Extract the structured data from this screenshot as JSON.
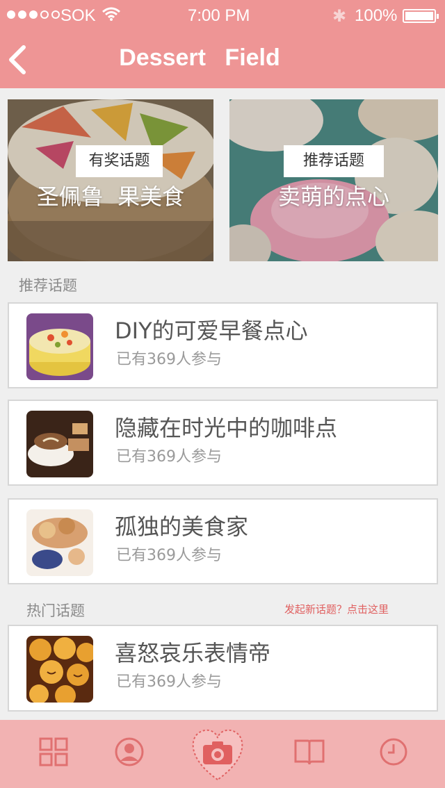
{
  "status_bar": {
    "carrier": "SOK",
    "time": "7:00 PM",
    "battery": "100%"
  },
  "nav": {
    "title": "Dessert Field"
  },
  "banners": [
    {
      "tag": "有奖话题",
      "title": "圣佩鲁 果美食"
    },
    {
      "tag": "推荐话题",
      "title": "卖萌的点心"
    }
  ],
  "sections": {
    "recommended": "推荐话题",
    "hot": "热门话题",
    "new_topic_link": "发起新话题？点击这里"
  },
  "topics": [
    {
      "title": "DIY的可爱早餐点心",
      "participants": "已有369人参与"
    },
    {
      "title": "隐藏在时光中的咖啡点",
      "participants": "已有369人参与"
    },
    {
      "title": "孤独的美食家",
      "participants": "已有369人参与"
    },
    {
      "title": "喜怒哀乐表情帝",
      "participants": "已有369人参与"
    }
  ],
  "tabbar": {
    "items": [
      "grid-icon",
      "profile-icon",
      "camera-icon",
      "book-icon",
      "clock-icon"
    ]
  },
  "colors": {
    "header": "#ee9595",
    "tabbar": "#f2b2b2",
    "accent": "#e06060",
    "icon": "#e07070"
  }
}
